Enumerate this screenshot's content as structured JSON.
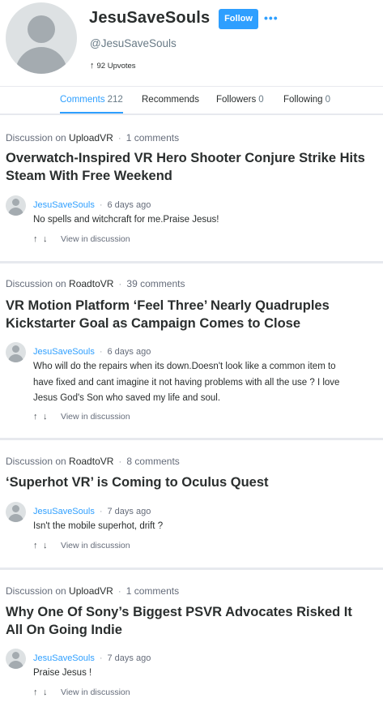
{
  "profile": {
    "username": "JesuSaveSouls",
    "handle": "@JesuSaveSouls",
    "follow_label": "Follow",
    "upvotes_label": "92 Upvotes",
    "more_icon": "more-dots-icon"
  },
  "tabs": [
    {
      "label": "Comments",
      "count": "212",
      "active": true
    },
    {
      "label": "Recommends",
      "count": "",
      "active": false
    },
    {
      "label": "Followers",
      "count": "0",
      "active": false
    },
    {
      "label": "Following",
      "count": "0",
      "active": false
    }
  ],
  "discussions": [
    {
      "prefix": "Discussion on",
      "forum": "UploadVR",
      "comments": "1 comments",
      "title": "Overwatch-Inspired VR Hero Shooter Conjure Strike Hits Steam With Free Weekend",
      "author": "JesuSaveSouls",
      "time": "6 days ago",
      "text": "No spells and witchcraft for me.Praise Jesus!",
      "view_label": "View in discussion"
    },
    {
      "prefix": "Discussion on",
      "forum": "RoadtoVR",
      "comments": "39 comments",
      "title": "VR Motion Platform ‘Feel Three’ Nearly Quadruples Kickstarter Goal as Campaign Comes to Close",
      "author": "JesuSaveSouls",
      "time": "6 days ago",
      "text": "Who will do the repairs when its down.Doesn't look like a common item to have fixed and cant imagine it not having problems with all the use ? I love Jesus God's Son who saved my life and soul.",
      "view_label": "View in discussion"
    },
    {
      "prefix": "Discussion on",
      "forum": "RoadtoVR",
      "comments": "8 comments",
      "title": "‘Superhot VR’ is Coming to Oculus Quest",
      "author": "JesuSaveSouls",
      "time": "7 days ago",
      "text": "Isn't the mobile superhot, drift ?",
      "view_label": "View in discussion"
    },
    {
      "prefix": "Discussion on",
      "forum": "UploadVR",
      "comments": "1 comments",
      "title": "Why One Of Sony’s Biggest PSVR Advocates Risked It All On Going Indie",
      "author": "JesuSaveSouls",
      "time": "7 days ago",
      "text": "Praise Jesus !",
      "view_label": "View in discussion"
    }
  ],
  "colors": {
    "accent": "#2e9fff",
    "text": "#2a2e2e",
    "muted": "#656c7a",
    "divider": "#e7e9ee"
  }
}
